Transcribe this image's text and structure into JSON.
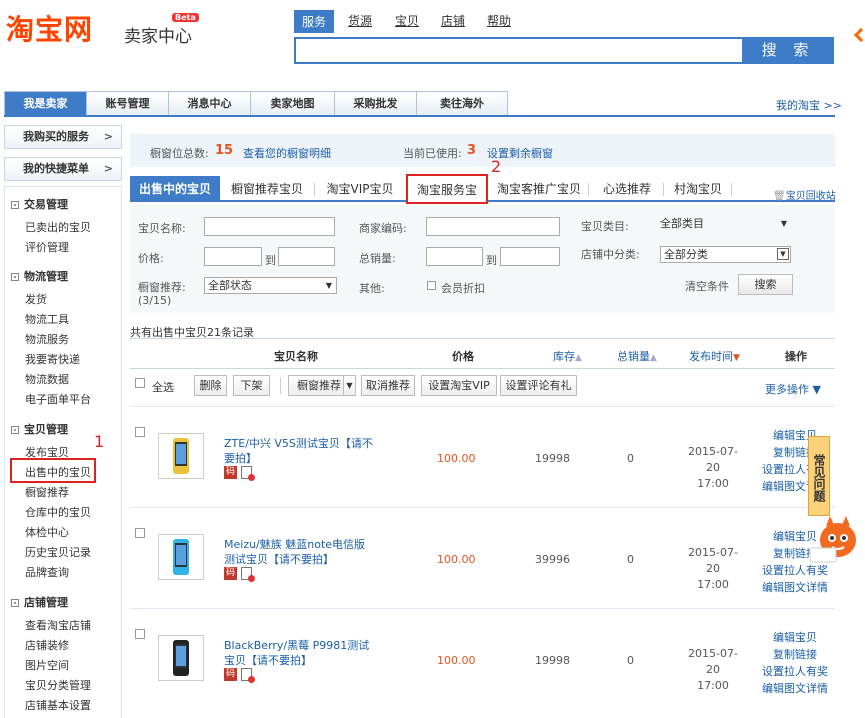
{
  "header": {
    "logo": "淘宝网",
    "subtitle": "卖家中心",
    "beta": "Beta",
    "nav": [
      "服务",
      "货源",
      "宝贝",
      "店铺",
      "帮助"
    ],
    "search_button": "搜 索"
  },
  "main_tabs": [
    "我是卖家",
    "账号管理",
    "消息中心",
    "卖家地图",
    "采购批发",
    "卖往海外"
  ],
  "my_taobao": "我的淘宝 >>",
  "sidebar": {
    "bought_services": "我购买的服务",
    "shortcut_menu": "我的快捷菜单",
    "groups": [
      {
        "label": "交易管理",
        "items": [
          "已卖出的宝贝",
          "评价管理"
        ]
      },
      {
        "label": "物流管理",
        "items": [
          "发货",
          "物流工具",
          "物流服务",
          "我要寄快递",
          "物流数据",
          "电子面单平台"
        ]
      },
      {
        "label": "宝贝管理",
        "items": [
          "发布宝贝",
          "出售中的宝贝",
          "橱窗推荐",
          "仓库中的宝贝",
          "体检中心",
          "历史宝贝记录",
          "品牌查询"
        ]
      },
      {
        "label": "店铺管理",
        "items": [
          "查看淘宝店铺",
          "店铺装修",
          "图片空间",
          "宝贝分类管理",
          "店铺基本设置"
        ]
      }
    ]
  },
  "annotations": {
    "mark1": "1",
    "mark2": "2"
  },
  "info_bar": {
    "slots_label": "橱窗位总数:",
    "slots_total": "15",
    "view_detail": "查看您的橱窗明细",
    "used_label": "当前已使用:",
    "used_count": "3",
    "set_remaining": "设置剩余橱窗"
  },
  "content_tabs": [
    "出售中的宝贝",
    "橱窗推荐宝贝",
    "淘宝VIP宝贝",
    "淘宝服务宝",
    "淘宝客推广宝贝",
    "心选推荐",
    "村淘宝贝"
  ],
  "recycle": "宝贝回收站",
  "filters": {
    "name_label": "宝贝名称:",
    "merchant_code_label": "商家编码:",
    "category_label": "宝贝类目:",
    "category_value": "全部类目",
    "price_label": "价格:",
    "to": "到",
    "sales_label": "总销量:",
    "shop_category_label": "店铺中分类:",
    "shop_category_value": "全部分类",
    "window_label": "橱窗推荐:",
    "window_count": "(3/15)",
    "window_value": "全部状态",
    "other_label": "其他:",
    "member_discount": "会员折扣",
    "clear": "清空条件",
    "search": "搜索"
  },
  "list": {
    "count_text": "共有出售中宝贝21条记录",
    "headers": {
      "name": "宝贝名称",
      "price": "价格",
      "stock": "库存",
      "sales": "总销量",
      "time": "发布时间",
      "ops": "操作"
    },
    "toolbar": {
      "select_all": "全选",
      "delete": "删除",
      "off_shelf": "下架",
      "window_recommend": "橱窗推荐",
      "cancel_recommend": "取消推荐",
      "set_vip": "设置淘宝VIP",
      "set_review_gift": "设置评论有礼",
      "more_ops": "更多操作 ▼"
    },
    "rows": [
      {
        "title": "ZTE/中兴 V5S测试宝贝【请不要拍】",
        "price": "100.00",
        "stock": "19998",
        "sold": "0",
        "date": "2015-07-20",
        "time": "17:00",
        "ops": [
          "编辑宝贝",
          "复制链接",
          "设置拉人有奖",
          "编辑图文详情"
        ],
        "phone_color": "#e8c23a"
      },
      {
        "title": "Meizu/魅族 魅蓝note电信版测试宝贝【请不要拍】",
        "price": "100.00",
        "stock": "39996",
        "sold": "0",
        "date": "2015-07-20",
        "time": "17:00",
        "ops": [
          "编辑宝贝",
          "复制链接",
          "设置拉人有奖",
          "编辑图文详情"
        ],
        "phone_color": "#2fb4e8"
      },
      {
        "title": "BlackBerry/黑莓 P9981测试宝贝【请不要拍】",
        "price": "100.00",
        "stock": "19998",
        "sold": "0",
        "date": "2015-07-20",
        "time": "17:00",
        "ops": [
          "编辑宝贝",
          "复制链接",
          "设置拉人有奖",
          "编辑图文详情"
        ],
        "phone_color": "#222222"
      }
    ],
    "badge_ma": "码"
  },
  "help": "常见问题"
}
